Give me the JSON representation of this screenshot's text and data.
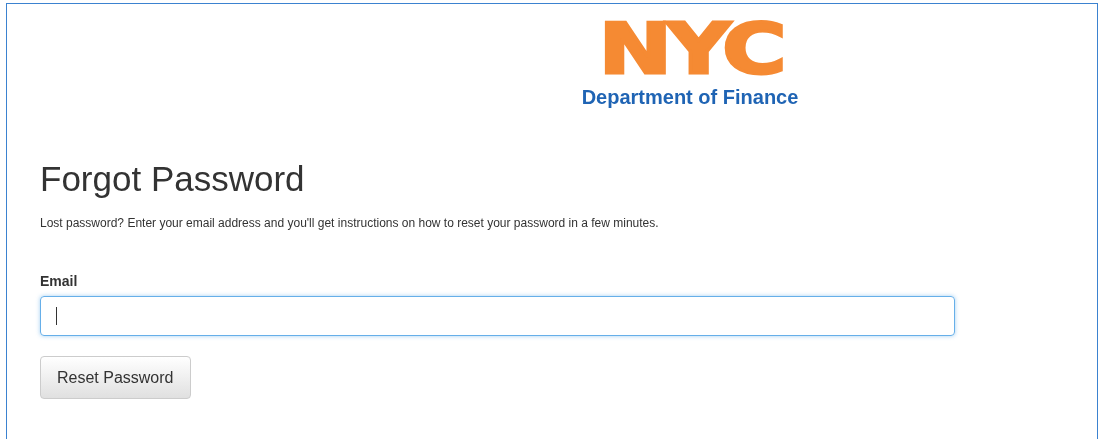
{
  "logo": {
    "mark": "NYC",
    "department": "Department of Finance"
  },
  "heading": "Forgot Password",
  "intro": "Lost password? Enter your email address and you'll get instructions on how to reset your password in a few minutes.",
  "email": {
    "label": "Email",
    "focused": true
  },
  "button": "Reset Password"
}
